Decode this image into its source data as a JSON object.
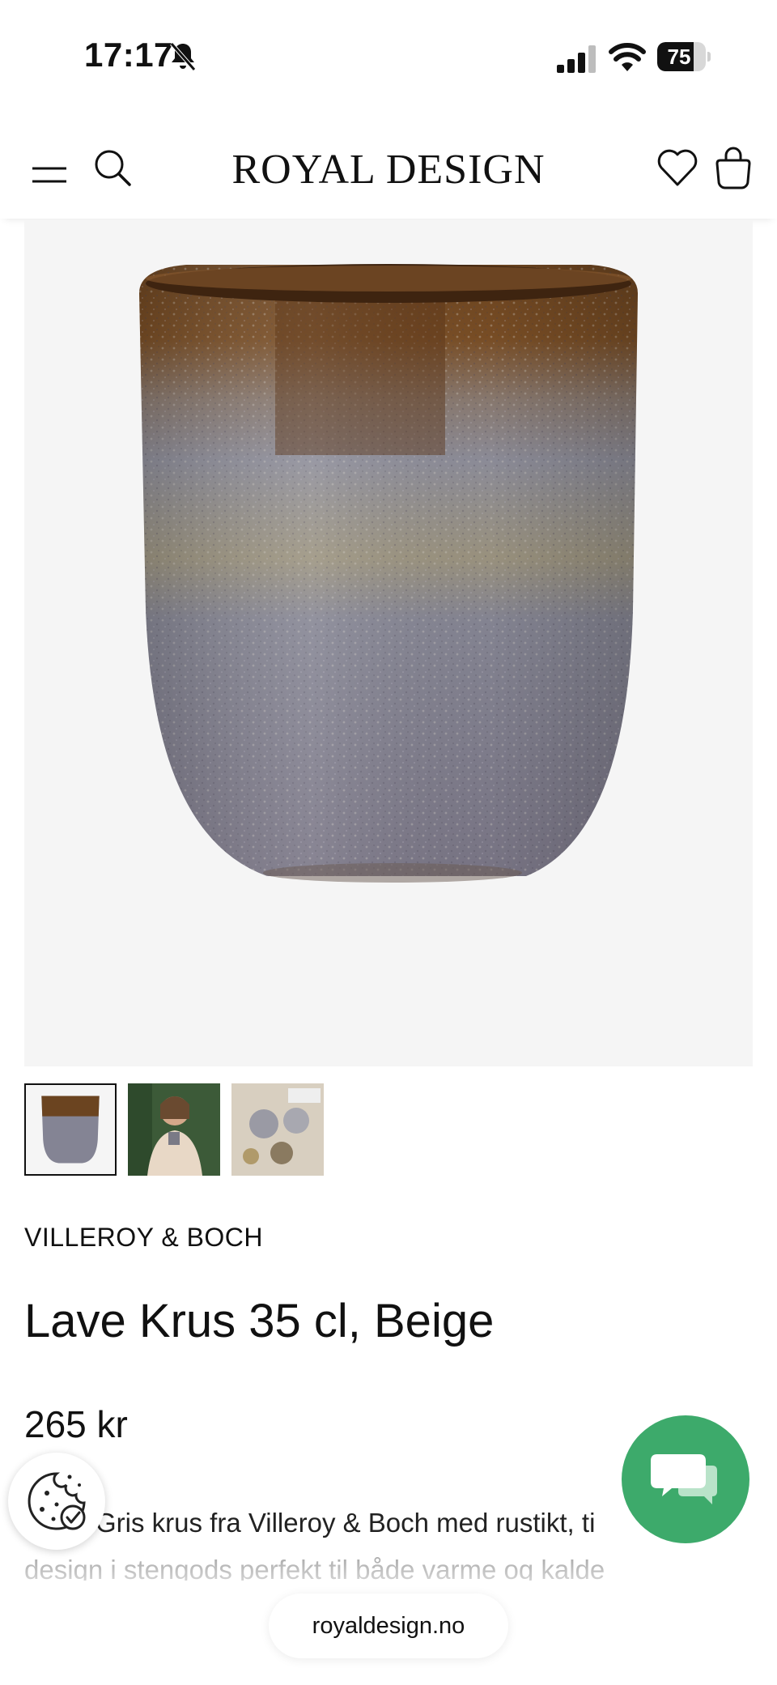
{
  "status_bar": {
    "time": "17:17",
    "battery_level": "75",
    "battery_fraction": 0.75,
    "icons": [
      "bell-slash-icon",
      "cellular-signal-icon",
      "wifi-icon",
      "battery-icon"
    ]
  },
  "header": {
    "logo": "ROYAL DESIGN",
    "icons": [
      "menu-icon",
      "search-icon",
      "heart-icon",
      "shopping-bag-icon"
    ]
  },
  "product": {
    "brand": "VILLEROY & BOCH",
    "title": "Lave Krus 35 cl, Beige",
    "price": "265 kr",
    "description": "Gris krus fra Villeroy & Boch med rustikt, tidløst design i steingods perfekt til både varme og kalde",
    "description_visible_line1": "Gris krus fra Villeroy & Boch med rustikt, ti",
    "description_visible_line2": "design i stengods perfekt til både varme og kalde",
    "thumbnails": [
      "mug",
      "woman holding mug",
      "table setting"
    ]
  },
  "floating": {
    "cookie_icon": "cookie-settings-icon",
    "chat_icon": "chat-bubbles-icon",
    "chat_color": "#3daa6b"
  },
  "browser": {
    "url": "royaldesign.no"
  }
}
